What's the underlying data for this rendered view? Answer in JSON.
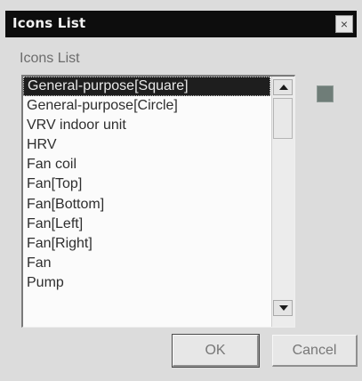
{
  "window": {
    "title": "Icons List",
    "close_label": "×"
  },
  "group_label": "Icons List",
  "list": {
    "selected_index": 0,
    "items": [
      "General-purpose[Square]",
      "General-purpose[Circle]",
      "VRV indoor unit",
      "HRV",
      "Fan coil",
      "Fan[Top]",
      "Fan[Bottom]",
      "Fan[Left]",
      "Fan[Right]",
      "Fan",
      "Pump"
    ]
  },
  "preview": {
    "icon": "square-icon",
    "color": "#6f7d78"
  },
  "buttons": {
    "ok_label": "OK",
    "cancel_label": "Cancel"
  }
}
